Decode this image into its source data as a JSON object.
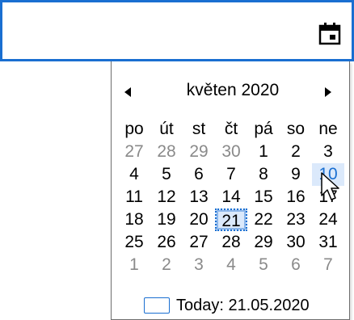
{
  "input": {
    "value": "",
    "placeholder": ""
  },
  "calendar": {
    "month_title": "květen 2020",
    "prev_icon": "triangle-left-icon",
    "next_icon": "triangle-right-icon",
    "weekdays": [
      "po",
      "út",
      "st",
      "čt",
      "pá",
      "so",
      "ne"
    ],
    "weeks": [
      [
        "27",
        "28",
        "29",
        "30",
        "1",
        "2",
        "3"
      ],
      [
        "4",
        "5",
        "6",
        "7",
        "8",
        "9",
        "10"
      ],
      [
        "11",
        "12",
        "13",
        "14",
        "15",
        "16",
        "17"
      ],
      [
        "18",
        "19",
        "20",
        "21",
        "22",
        "23",
        "24"
      ],
      [
        "25",
        "26",
        "27",
        "28",
        "29",
        "30",
        "31"
      ],
      [
        "1",
        "2",
        "3",
        "4",
        "5",
        "6",
        "7"
      ]
    ],
    "selected_day": "21",
    "hovered_day": "10",
    "today_label": "Today: 21.05.2020"
  },
  "colors": {
    "accent": "#1a6fd1",
    "hover_bg": "#dbe9fb",
    "muted": "#8a8a8a"
  }
}
